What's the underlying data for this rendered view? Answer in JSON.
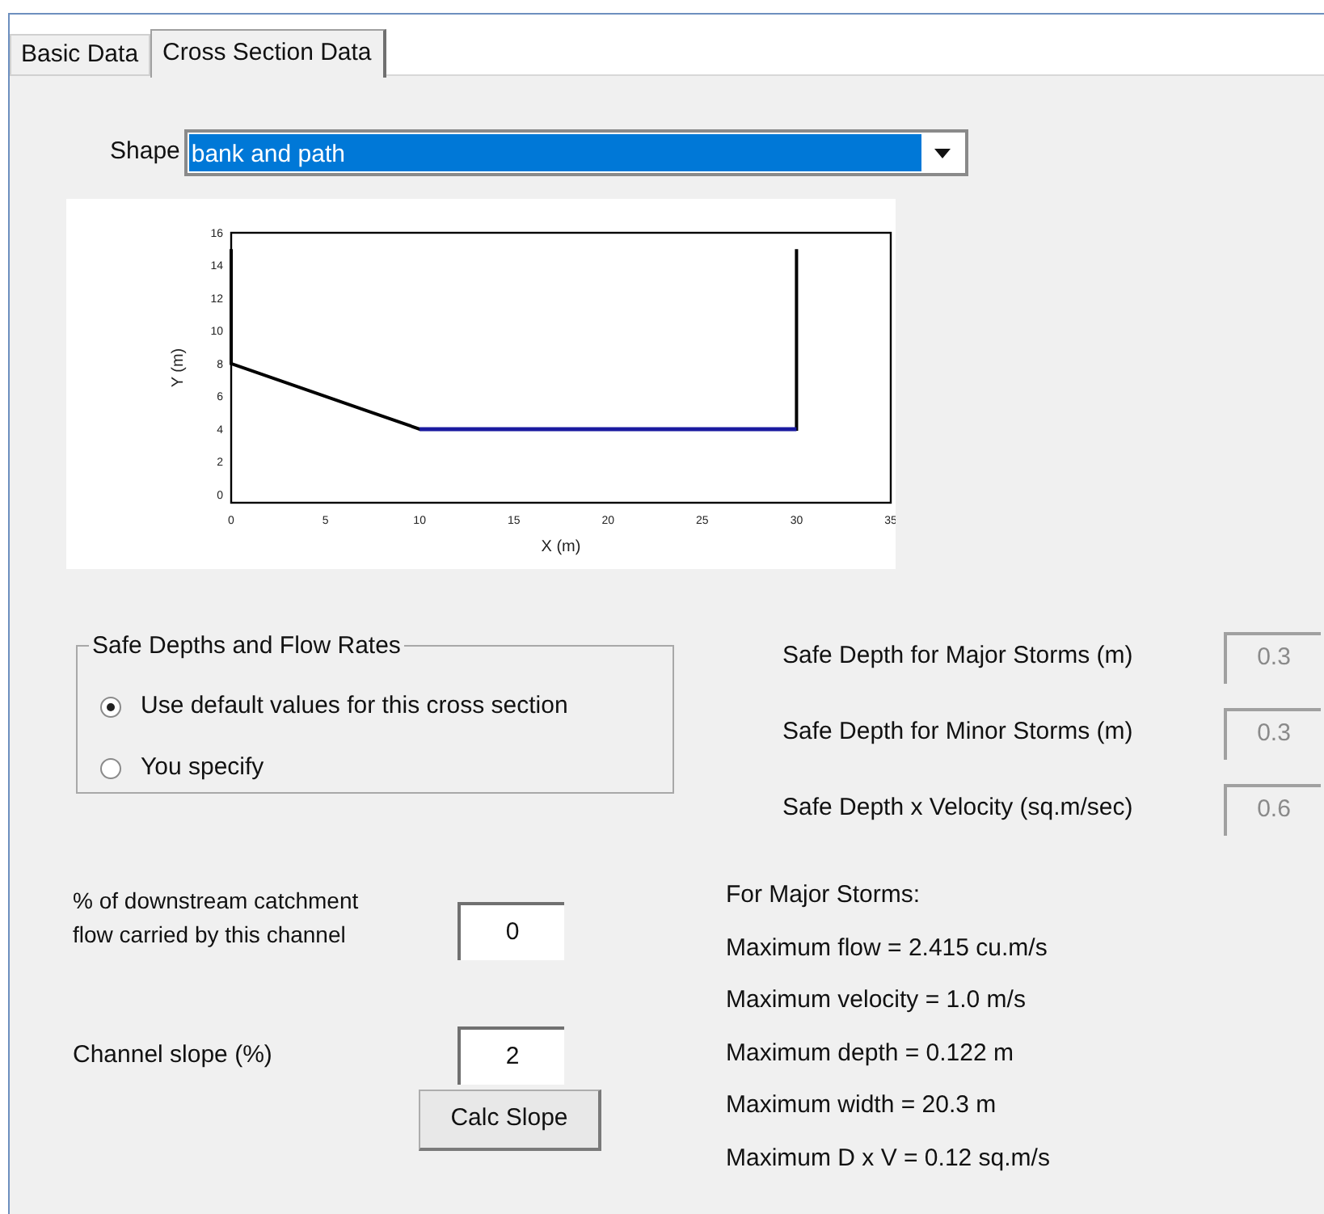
{
  "tabs": [
    {
      "label": "Basic Data",
      "selected": false
    },
    {
      "label": "Cross Section Data",
      "selected": true
    }
  ],
  "shape": {
    "label": "Shape",
    "value": "bank and path"
  },
  "chart": {
    "chart_data": {
      "type": "line",
      "xlabel": "X (m)",
      "ylabel": "Y (m)",
      "x": [
        0,
        0,
        10,
        30,
        30
      ],
      "xlim": [
        0,
        35
      ],
      "ylim": [
        -0.5,
        16
      ],
      "xticks": [
        0,
        5,
        10,
        15,
        20,
        25,
        30,
        35
      ],
      "yticks": [
        0,
        2,
        4,
        6,
        8,
        10,
        12,
        14,
        16
      ],
      "series": [
        {
          "color": "#000000",
          "values": [
            15,
            8,
            4,
            4,
            15
          ]
        },
        {
          "color": "#1a1aa0",
          "values": [
            null,
            null,
            4,
            4,
            null
          ]
        }
      ]
    }
  },
  "safe_depths": {
    "title": "Safe Depths and Flow Rates",
    "options": [
      {
        "label": "Use default values for this cross section",
        "selected": true
      },
      {
        "label": "You specify",
        "selected": false
      }
    ]
  },
  "safe_fields": [
    {
      "label": "Safe Depth for Major Storms (m)",
      "value": "0.3",
      "disabled": true
    },
    {
      "label": "Safe Depth for Minor Storms (m)",
      "value": "0.3",
      "disabled": true
    },
    {
      "label": "Safe Depth x Velocity (sq.m/sec)",
      "value": "0.6",
      "disabled": true
    }
  ],
  "downstream": {
    "label": "% of downstream catchment flow carried by this channel",
    "value": "0"
  },
  "slope": {
    "label": "Channel slope (%)",
    "value": "2",
    "button": "Calc Slope"
  },
  "results": {
    "title": "For Major Storms:",
    "lines": [
      "Maximum flow = 2.415 cu.m/s",
      "Maximum velocity = 1.0 m/s",
      "Maximum depth = 0.122 m",
      "Maximum width = 20.3 m",
      "Maximum D x V = 0.12 sq.m/s"
    ]
  }
}
